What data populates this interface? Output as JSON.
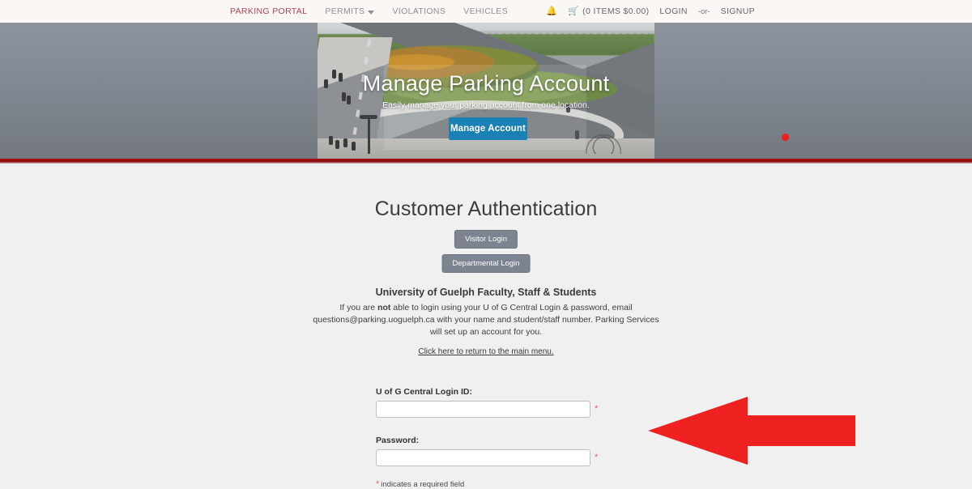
{
  "nav": {
    "left_items": [
      {
        "label": "PARKING PORTAL",
        "name": "nav-parking-portal",
        "brand": true,
        "caret": false
      },
      {
        "label": "PERMITS",
        "name": "nav-permits",
        "brand": false,
        "caret": true
      },
      {
        "label": "VIOLATIONS",
        "name": "nav-violations",
        "brand": false,
        "caret": false
      },
      {
        "label": "VEHICLES",
        "name": "nav-vehicles",
        "brand": false,
        "caret": false
      }
    ],
    "bell_icon": "bell-icon",
    "cart_icon": "cart-icon",
    "cart_label": "(0 ITEMS $0.00)",
    "login_label": "LOGIN",
    "separator": "-or-",
    "signup_label": "SIGNUP",
    "brand_color": "#b5404f",
    "background": "#faf7f4"
  },
  "hero": {
    "title": "Manage Parking Account",
    "subtitle": "Easily manage your parking account from one location.",
    "button_label": "Manage Account",
    "button_color": "#1b80b3",
    "rule_color": "#a30f12"
  },
  "page": {
    "title": "Customer Authentication"
  },
  "buttons": {
    "visitor_login": "Visitor Login",
    "departmental_login": "Departmental Login",
    "gray_color": "#7b8490"
  },
  "info": {
    "heading": "University of Guelph Faculty, Staff & Students",
    "body_part1": "If you are ",
    "body_bold": "not",
    "body_part2": " able to login using your U of G Central Login & password, email questions@parking.uoguelph.ca with your name and student/staff number.  Parking Services will set up an account for you.",
    "main_menu_link": "Click here to return to the main menu."
  },
  "form": {
    "login_id_label": "U of G Central Login ID:",
    "login_id_value": "",
    "login_id_placeholder": "",
    "password_label": "Password:",
    "password_value": "",
    "password_placeholder": "",
    "required_star": "*",
    "required_note": "indicates a required field",
    "required_color": "#e0635f"
  },
  "annotations": {
    "arrow": {
      "name": "red-arrow-annotation",
      "direction": "left",
      "color": "#ef2020"
    },
    "cursor_dot": {
      "name": "cursor-dot",
      "color": "#f21a1a"
    }
  }
}
